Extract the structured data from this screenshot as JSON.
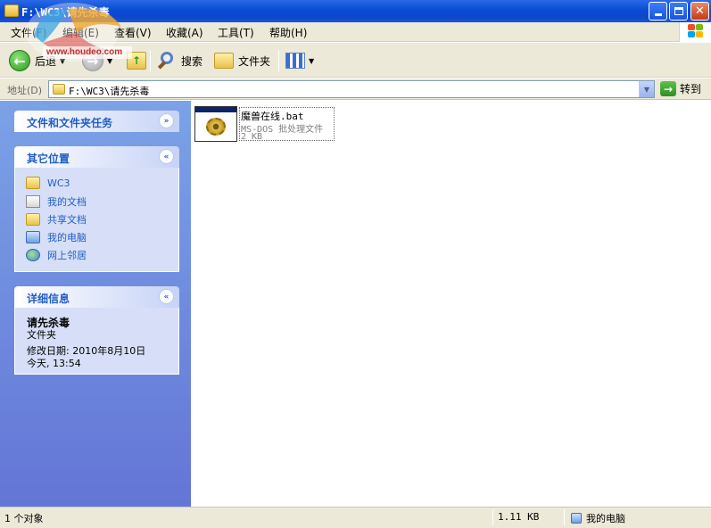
{
  "window": {
    "title": "F:\\WC3\\请先杀毒"
  },
  "watermark": {
    "site": "www.houdeo.com"
  },
  "menu": [
    "文件(F)",
    "编辑(E)",
    "查看(V)",
    "收藏(A)",
    "工具(T)",
    "帮助(H)"
  ],
  "toolbar": {
    "back": "后退",
    "search": "搜索",
    "folders": "文件夹"
  },
  "address": {
    "label": "地址(D)",
    "value": "F:\\WC3\\请先杀毒",
    "go": "转到"
  },
  "left_pane": {
    "tasks_title": "文件和文件夹任务",
    "other_title": "其它位置",
    "other_links": [
      "WC3",
      "我的文档",
      "共享文档",
      "我的电脑",
      "网上邻居"
    ],
    "details_title": "详细信息",
    "details_name": "请先杀毒",
    "details_type": "文件夹",
    "details_modified": "修改日期: 2010年8月10日",
    "details_time": "今天, 13:54"
  },
  "files": [
    {
      "name": "魔兽在线.bat",
      "type": "MS-DOS 批处理文件",
      "size": "2 KB"
    }
  ],
  "status": {
    "count": "1 个对象",
    "size": "1.11 KB",
    "location": "我的电脑"
  }
}
